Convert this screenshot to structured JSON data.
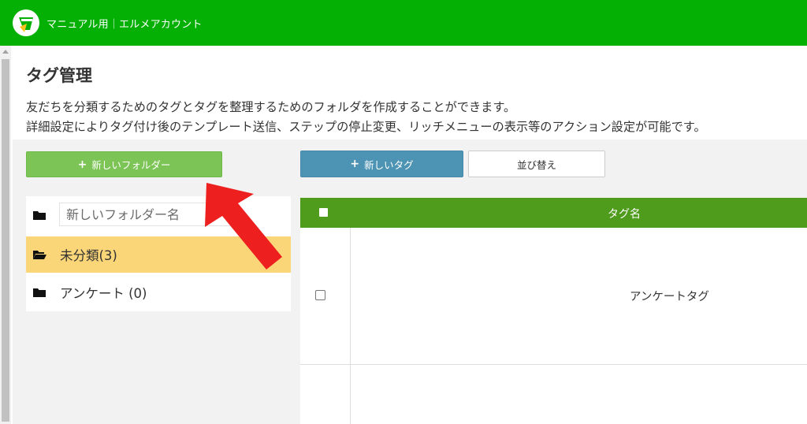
{
  "header": {
    "account_name": "マニュアル用｜エルメアカウント",
    "bar_color": "#03b003"
  },
  "page": {
    "title": "タグ管理",
    "description_line1": "友だちを分類するためのタグとタグを整理するためのフォルダを作成することができます。",
    "description_line2": "詳細設定によりタグ付け後のテンプレート送信、ステップの停止変更、リッチメニューの表示等のアクション設定が可能です。"
  },
  "toolbar": {
    "new_folder_label": "新しいフォルダー",
    "new_tag_label": "新しいタグ",
    "sort_label": "並び替え",
    "plus_icon": "+"
  },
  "folders": {
    "input_placeholder": "新しいフォルダー名",
    "items": [
      {
        "label": "未分類(3)",
        "active": true
      },
      {
        "label": "アンケート (0)",
        "active": false
      }
    ],
    "active_color": "#fbd679"
  },
  "tag_table": {
    "header_color": "#4f9c1c",
    "column_name": "タグ名",
    "rows": [
      {
        "name": "アンケートタグ",
        "checked": false
      }
    ]
  },
  "annotation": {
    "arrow_color": "#ee1f1f",
    "icon": "red-pointer-arrow-icon"
  }
}
